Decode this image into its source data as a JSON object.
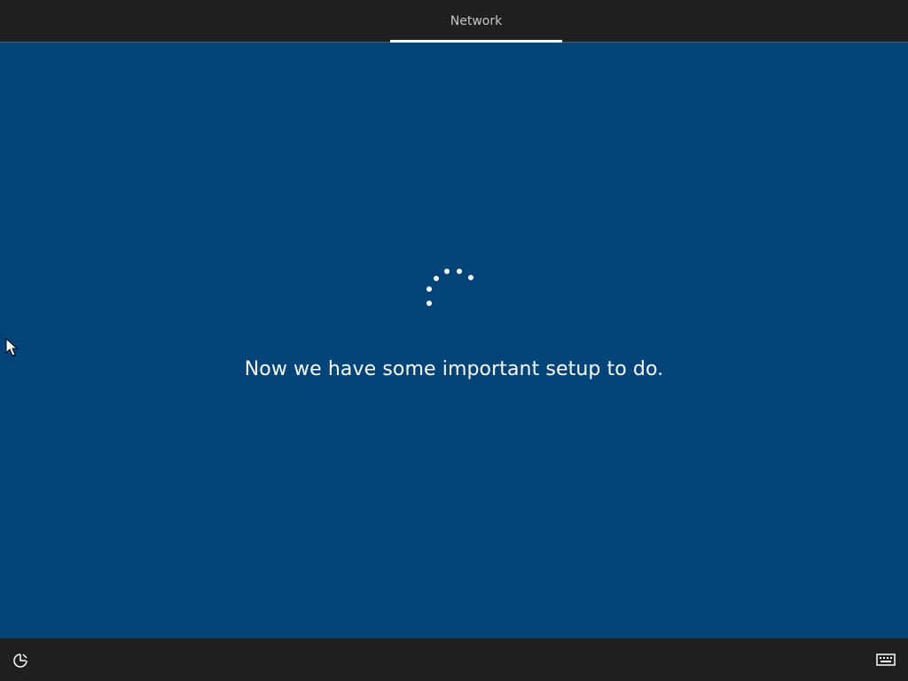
{
  "header": {
    "tabs": [
      {
        "label": "Network",
        "active": true
      }
    ]
  },
  "main": {
    "message": "Now we have some important setup to do."
  },
  "footer": {
    "left_icon": "ease-of-access-icon",
    "right_icon": "keyboard-icon"
  },
  "colors": {
    "background": "#00447a",
    "bar": "#1f1f1f",
    "text": "#ffffff",
    "tab_text": "#c8c8c8"
  }
}
